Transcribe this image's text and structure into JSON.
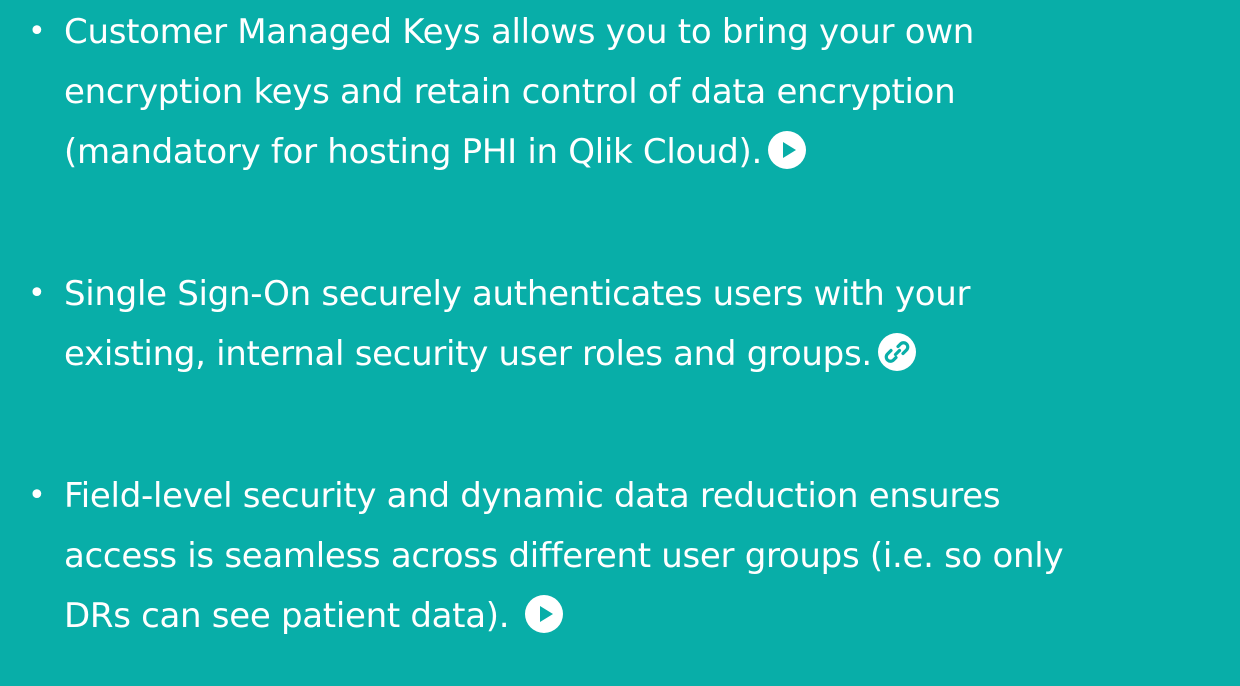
{
  "slide": {
    "background_color": "#08aea8",
    "text_color": "#ffffff",
    "bullets": [
      {
        "lines": [
          "Customer Managed Keys allows you to bring your own",
          "encryption keys and retain control of data encryption",
          "(mandatory for hosting PHI in Qlik Cloud)."
        ],
        "icon": "play-icon"
      },
      {
        "lines": [
          "Single Sign-On securely authenticates users with your",
          "existing, internal security user roles and groups."
        ],
        "icon": "link-icon"
      },
      {
        "lines": [
          "Field-level security and dynamic data reduction ensures",
          "access is seamless across different user groups (i.e. so only",
          "DRs can see patient data)."
        ],
        "icon": "play-icon"
      }
    ]
  }
}
